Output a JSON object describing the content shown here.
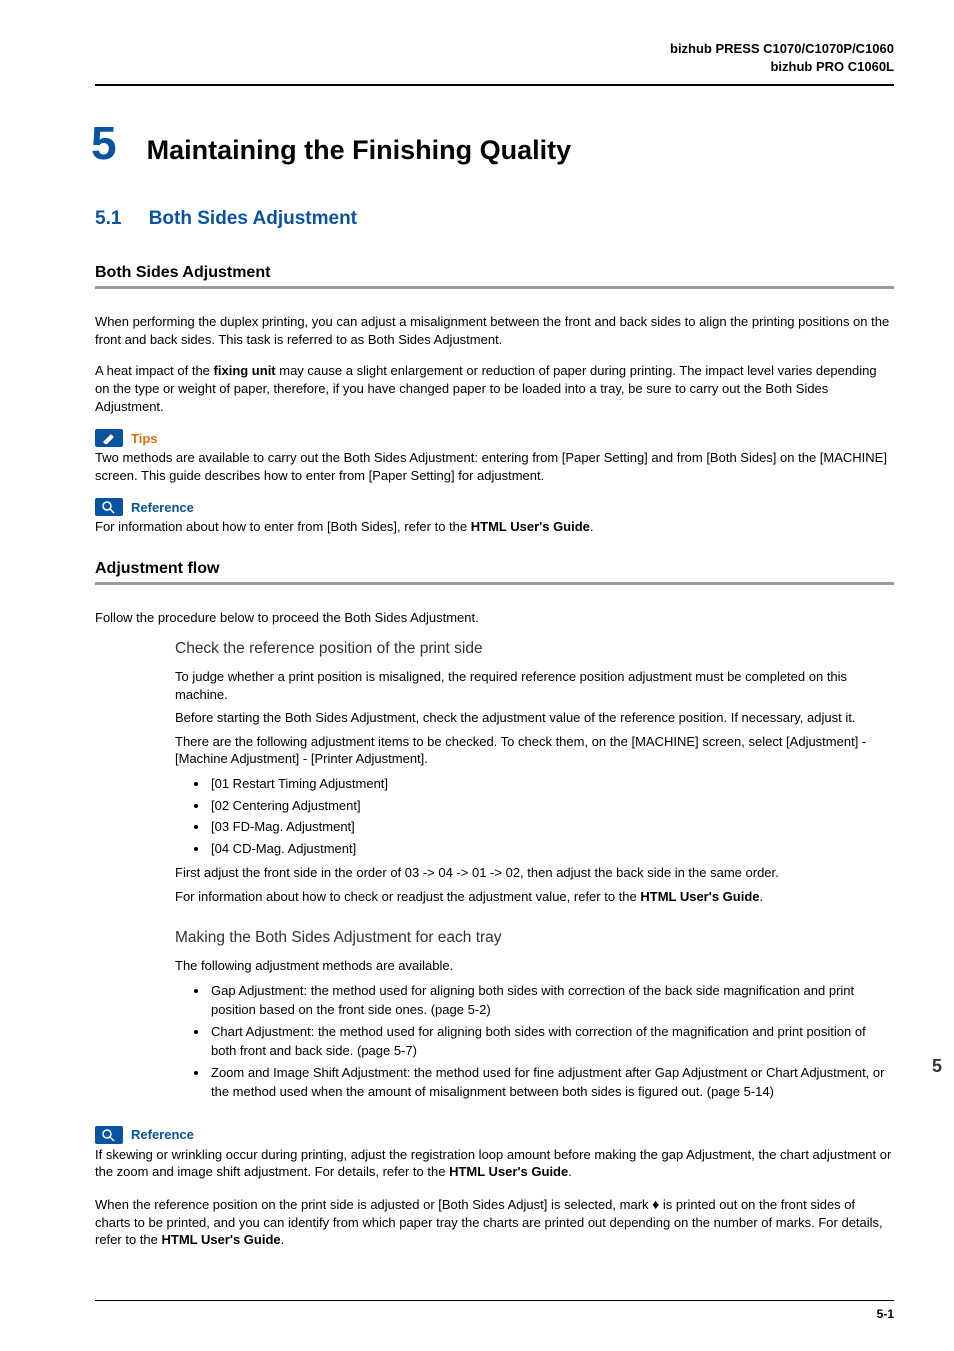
{
  "header": {
    "line1": "bizhub PRESS C1070/C1070P/C1060",
    "line2": "bizhub PRO C1060L"
  },
  "chapter": {
    "number": "5",
    "title": "Maintaining the Finishing Quality"
  },
  "section": {
    "number": "5.1",
    "title": "Both Sides Adjustment"
  },
  "sub1": {
    "heading": "Both Sides Adjustment",
    "p1": "When performing the duplex printing, you can adjust a misalignment between the front and back sides to align the printing positions on the front and back sides. This task is referred to as Both Sides Adjustment.",
    "p2a": "A heat impact of the ",
    "p2b": "fixing unit",
    "p2c": " may cause a slight enlargement or reduction of paper during printing. The impact level varies depending on the type or weight of paper, therefore, if you have changed paper to be loaded into a tray, be sure to carry out the Both Sides Adjustment."
  },
  "tips": {
    "label": "Tips",
    "text": "Two methods are available to carry out the Both Sides Adjustment: entering from [Paper Setting] and from [Both Sides] on the [MACHINE] screen. This guide describes how to enter from [Paper Setting] for adjustment."
  },
  "ref1": {
    "label": "Reference",
    "pre": "For information about how to enter from [Both Sides], refer to the ",
    "link": "HTML User's Guide",
    "post": "."
  },
  "sub2": {
    "heading": "Adjustment flow",
    "intro": "Follow the procedure below to proceed the Both Sides Adjustment."
  },
  "step1": {
    "title": "Check the reference position of the print side",
    "p1": "To judge whether a print position is misaligned, the required reference position adjustment must be completed on this machine.",
    "p2": "Before starting the Both Sides Adjustment, check the adjustment value of the reference position. If necessary, adjust it.",
    "p3": "There are the following adjustment items to be checked. To check them, on the [MACHINE] screen, select [Adjustment] - [Machine Adjustment] - [Printer Adjustment].",
    "items": [
      "[01 Restart Timing Adjustment]",
      "[02 Centering Adjustment]",
      "[03 FD-Mag. Adjustment]",
      "[04 CD-Mag. Adjustment]"
    ],
    "p4": "First adjust the front side in the order of 03 -> 04 -> 01 -> 02, then adjust the back side in the same order.",
    "p5a": "For information about how to check or readjust the adjustment value, refer to the ",
    "p5b": "HTML User's Guide",
    "p5c": "."
  },
  "step2": {
    "title": "Making the Both Sides Adjustment for each tray",
    "intro": "The following adjustment methods are available.",
    "items": [
      "Gap Adjustment: the method used for aligning both sides with correction of the back side magnification and print position based on the front side ones. (page 5-2)",
      "Chart Adjustment: the method used for aligning both sides with correction of the magnification and print position of both front and back side. (page 5-7)",
      "Zoom and Image Shift Adjustment: the method used for fine adjustment after Gap Adjustment or Chart Adjustment, or the method used when the amount of misalignment between both sides is figured out. (page 5-14)"
    ]
  },
  "ref2": {
    "label": "Reference",
    "p1a": "If skewing or wrinkling occur during printing, adjust the registration loop amount before making the gap Adjustment, the chart adjustment or the zoom and image shift adjustment. For details, refer to the ",
    "p1b": "HTML User's Guide",
    "p1c": ".",
    "p2a": "When the reference position on the print side is adjusted or [Both Sides Adjust] is selected, mark ",
    "p2mark": "♦",
    "p2b": " is printed out on the front sides of charts to be printed, and you can identify from which paper tray the charts are printed out depending on the number of marks. For details, refer to the ",
    "p2c": "HTML User's Guide",
    "p2d": "."
  },
  "footer": {
    "pagenum": "5-1"
  },
  "sidetab": "5"
}
